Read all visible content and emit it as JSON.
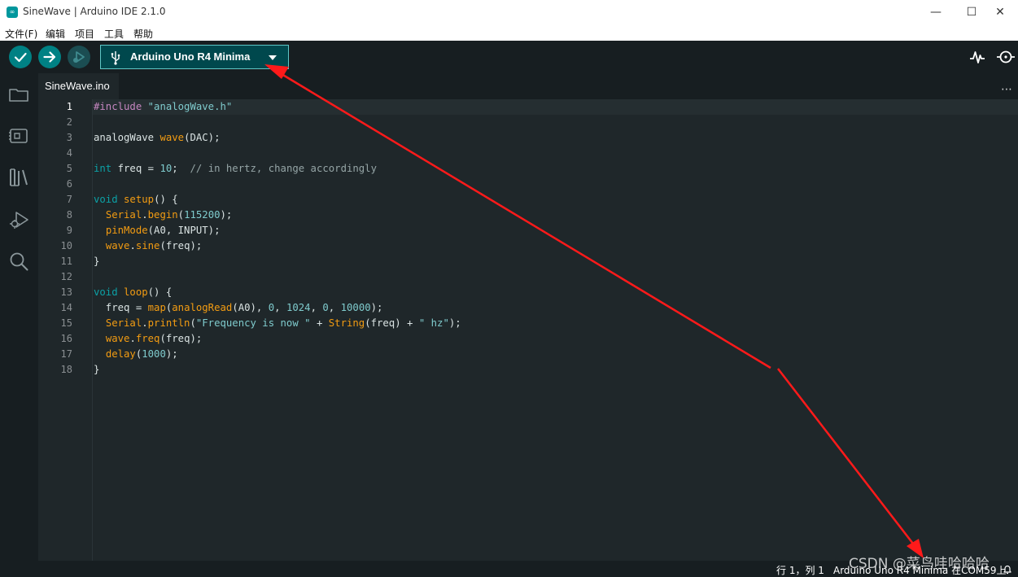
{
  "window": {
    "title": "SineWave | Arduino IDE 2.1.0",
    "app_icon": "arduino-logo-icon",
    "controls": {
      "minimize": "—",
      "maximize": "☐",
      "close": "✕"
    }
  },
  "menu": [
    {
      "label": "文件(F)"
    },
    {
      "label": "编辑"
    },
    {
      "label": "项目"
    },
    {
      "label": "工具"
    },
    {
      "label": "帮助"
    }
  ],
  "toolbar": {
    "verify": "check-icon",
    "upload": "arrow-right-icon",
    "debug": "debug-icon",
    "board": {
      "icon": "usb-icon",
      "label": "Arduino Uno R4 Minima"
    },
    "serial_plotter": "plotter-icon",
    "serial_monitor": "serial-monitor-icon"
  },
  "sidebar": [
    {
      "icon": "folder-icon"
    },
    {
      "icon": "board-manager-icon"
    },
    {
      "icon": "library-icon"
    },
    {
      "icon": "debug-icon"
    },
    {
      "icon": "search-icon"
    }
  ],
  "tabs": [
    {
      "label": "SineWave.ino",
      "active": true
    }
  ],
  "tab_more": "⋯",
  "editor": {
    "active_line": 1,
    "line_numbers": [
      "1",
      "2",
      "3",
      "4",
      "5",
      "6",
      "7",
      "8",
      "9",
      "10",
      "11",
      "12",
      "13",
      "14",
      "15",
      "16",
      "17",
      "18"
    ],
    "lines": [
      [
        {
          "t": "pre",
          "v": "#include "
        },
        {
          "t": "str",
          "v": "\"analogWave.h\""
        }
      ],
      [],
      [
        {
          "t": "plain",
          "v": "analogWave "
        },
        {
          "t": "fn",
          "v": "wave"
        },
        {
          "t": "plain",
          "v": "(DAC);"
        }
      ],
      [],
      [
        {
          "t": "kw",
          "v": "int"
        },
        {
          "t": "plain",
          "v": " freq = "
        },
        {
          "t": "num",
          "v": "10"
        },
        {
          "t": "plain",
          "v": ";  "
        },
        {
          "t": "cm",
          "v": "// in hertz, change accordingly"
        }
      ],
      [],
      [
        {
          "t": "kw",
          "v": "void"
        },
        {
          "t": "plain",
          "v": " "
        },
        {
          "t": "fn",
          "v": "setup"
        },
        {
          "t": "plain",
          "v": "() {"
        }
      ],
      [
        {
          "t": "plain",
          "v": "  "
        },
        {
          "t": "fn",
          "v": "Serial"
        },
        {
          "t": "plain",
          "v": "."
        },
        {
          "t": "fn",
          "v": "begin"
        },
        {
          "t": "plain",
          "v": "("
        },
        {
          "t": "num",
          "v": "115200"
        },
        {
          "t": "plain",
          "v": ");"
        }
      ],
      [
        {
          "t": "plain",
          "v": "  "
        },
        {
          "t": "fn",
          "v": "pinMode"
        },
        {
          "t": "plain",
          "v": "(A0, INPUT);"
        }
      ],
      [
        {
          "t": "plain",
          "v": "  "
        },
        {
          "t": "fn",
          "v": "wave"
        },
        {
          "t": "plain",
          "v": "."
        },
        {
          "t": "fn",
          "v": "sine"
        },
        {
          "t": "plain",
          "v": "(freq);"
        }
      ],
      [
        {
          "t": "plain",
          "v": "}"
        }
      ],
      [],
      [
        {
          "t": "kw",
          "v": "void"
        },
        {
          "t": "plain",
          "v": " "
        },
        {
          "t": "fn",
          "v": "loop"
        },
        {
          "t": "plain",
          "v": "() {"
        }
      ],
      [
        {
          "t": "plain",
          "v": "  freq = "
        },
        {
          "t": "fn",
          "v": "map"
        },
        {
          "t": "plain",
          "v": "("
        },
        {
          "t": "fn",
          "v": "analogRead"
        },
        {
          "t": "plain",
          "v": "(A0), "
        },
        {
          "t": "num",
          "v": "0"
        },
        {
          "t": "plain",
          "v": ", "
        },
        {
          "t": "num",
          "v": "1024"
        },
        {
          "t": "plain",
          "v": ", "
        },
        {
          "t": "num",
          "v": "0"
        },
        {
          "t": "plain",
          "v": ", "
        },
        {
          "t": "num",
          "v": "10000"
        },
        {
          "t": "plain",
          "v": ");"
        }
      ],
      [
        {
          "t": "plain",
          "v": "  "
        },
        {
          "t": "fn",
          "v": "Serial"
        },
        {
          "t": "plain",
          "v": "."
        },
        {
          "t": "fn",
          "v": "println"
        },
        {
          "t": "plain",
          "v": "("
        },
        {
          "t": "str",
          "v": "\"Frequency is now \""
        },
        {
          "t": "plain",
          "v": " + "
        },
        {
          "t": "fn",
          "v": "String"
        },
        {
          "t": "plain",
          "v": "(freq) + "
        },
        {
          "t": "str",
          "v": "\" hz\""
        },
        {
          "t": "plain",
          "v": ");"
        }
      ],
      [
        {
          "t": "plain",
          "v": "  "
        },
        {
          "t": "fn",
          "v": "wave"
        },
        {
          "t": "plain",
          "v": "."
        },
        {
          "t": "fn",
          "v": "freq"
        },
        {
          "t": "plain",
          "v": "(freq);"
        }
      ],
      [
        {
          "t": "plain",
          "v": "  "
        },
        {
          "t": "fn",
          "v": "delay"
        },
        {
          "t": "plain",
          "v": "("
        },
        {
          "t": "num",
          "v": "1000"
        },
        {
          "t": "plain",
          "v": ");"
        }
      ],
      [
        {
          "t": "plain",
          "v": "}"
        }
      ]
    ]
  },
  "status": {
    "cursor": "行 1，列 1",
    "board_port": "Arduino Uno R4 Minima 在COM59上",
    "bell": "bell-icon"
  },
  "watermark": "CSDN @菜鸟哇哈哈哈",
  "colors": {
    "teal": "#008184",
    "annotation_red": "#ff1a1a"
  }
}
